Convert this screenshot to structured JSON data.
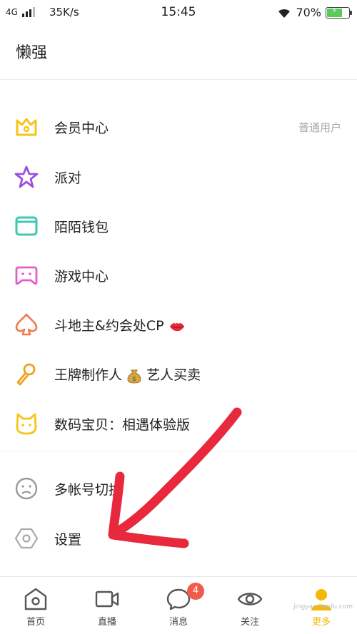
{
  "status_bar": {
    "network": "4G",
    "speed": "35K/s",
    "time": "15:45",
    "battery": "70%",
    "battery_level": 0.7
  },
  "header": {
    "title": "懒强"
  },
  "menu": {
    "items": [
      {
        "label": "会员中心",
        "extra": "普通用户",
        "icon": "crown-icon",
        "color": "#f5c518"
      },
      {
        "label": "派对",
        "icon": "star-icon",
        "color": "#9b4fe0"
      },
      {
        "label": "陌陌钱包",
        "icon": "wallet-icon",
        "color": "#3cc9b0"
      },
      {
        "label": "游戏中心",
        "icon": "gamepad-icon",
        "color": "#e85cc8"
      },
      {
        "label": "斗地主&约会处CP",
        "icon": "spade-icon",
        "color": "#f07a4a"
      },
      {
        "label": "王牌制作人",
        "label_suffix": "艺人买卖",
        "icon": "microphone-icon",
        "color": "#f0a020"
      },
      {
        "label": "数码宝贝：相遇体验版",
        "icon": "cat-icon",
        "color": "#f5c518"
      },
      {
        "label": "多帐号切换",
        "icon": "account-switch-icon",
        "color": "#999999"
      },
      {
        "label": "设置",
        "icon": "settings-hexagon-icon",
        "color": "#999999"
      }
    ]
  },
  "bottom_nav": {
    "items": [
      {
        "label": "首页",
        "icon": "home-icon"
      },
      {
        "label": "直播",
        "icon": "video-camera-icon"
      },
      {
        "label": "消息",
        "icon": "chat-bubble-icon",
        "badge": "4"
      },
      {
        "label": "关注",
        "icon": "eye-icon"
      },
      {
        "label": "更多",
        "icon": "user-icon",
        "active": true
      }
    ]
  },
  "watermark": "jingyan.baidu.com",
  "colors": {
    "accent": "#f5b800",
    "badge": "#f25a4a",
    "annotation_arrow": "#e8283c"
  }
}
